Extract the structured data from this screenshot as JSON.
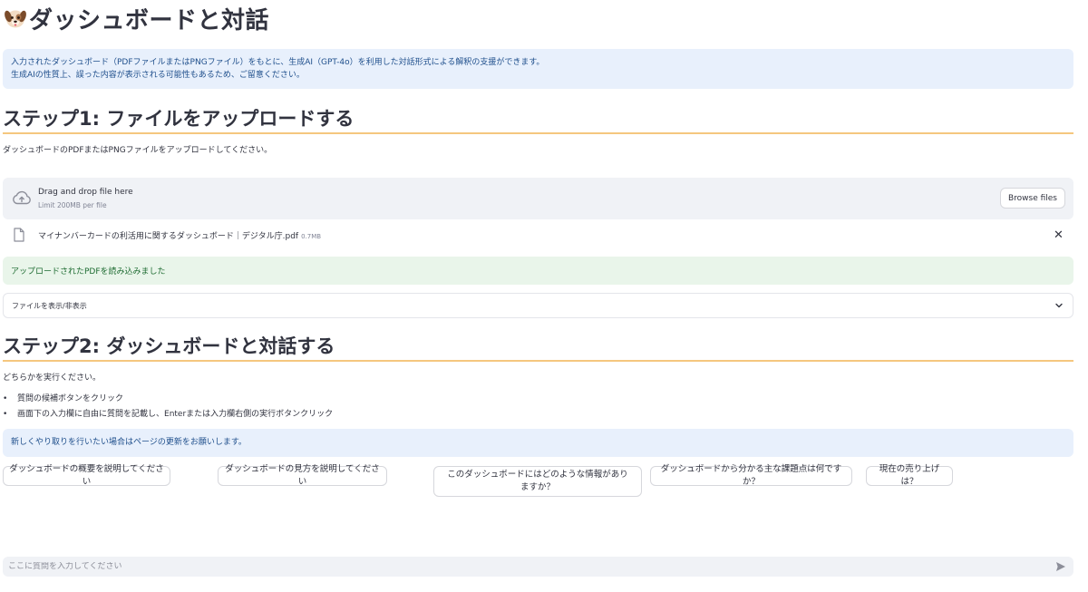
{
  "header": {
    "title": "ダッシュボードと対話",
    "icon": "dog-face-icon"
  },
  "intro": {
    "line1": "入力されたダッシュボード（PDFファイルまたはPNGファイル）をもとに、生成AI（GPT-4o）を利用した対話形式による解釈の支援ができます。",
    "line2": "生成AIの性質上、誤った内容が表示される可能性もあるため、ご留意ください。"
  },
  "step1": {
    "heading": "ステップ1: ファイルをアップロードする",
    "instruction": "ダッシュボードのPDFまたはPNGファイルをアップロードしてください。"
  },
  "uploader": {
    "drag_text": "Drag and drop file here",
    "limit_text": "Limit 200MB per file",
    "browse_label": "Browse files"
  },
  "uploaded_file": {
    "name": "マイナンバーカードの利活用に関するダッシュボード｜デジタル庁.pdf",
    "size": "0.7MB"
  },
  "success_message": "アップロードされたPDFを読み込みました",
  "expander_label": "ファイルを表示/非表示",
  "step2": {
    "heading": "ステップ2: ダッシュボードと対話する",
    "instruction": "どちらかを実行ください。",
    "bullets": [
      "質問の候補ボタンをクリック",
      "画面下の入力欄に自由に質問を記載し、Enterまたは入力欄右側の実行ボタンクリック"
    ],
    "refresh_note": "新しくやり取りを行いたい場合はページの更新をお願いします。"
  },
  "suggestions": [
    "ダッシュボードの概要を説明してください",
    "ダッシュボードの見方を説明してください",
    "このダッシュボードにはどのような情報がありますか？",
    "ダッシュボードから分かる主な課題点は何ですか？",
    "現在の売り上げは？"
  ],
  "chat_input": {
    "placeholder": "ここに質問を入力してください"
  },
  "colors": {
    "info_bg": "#e8f0fc",
    "info_text": "#1f4f8c",
    "success_bg": "#e9f5ea",
    "success_text": "#1d6b31",
    "heading_rule": "#f5c77e"
  }
}
